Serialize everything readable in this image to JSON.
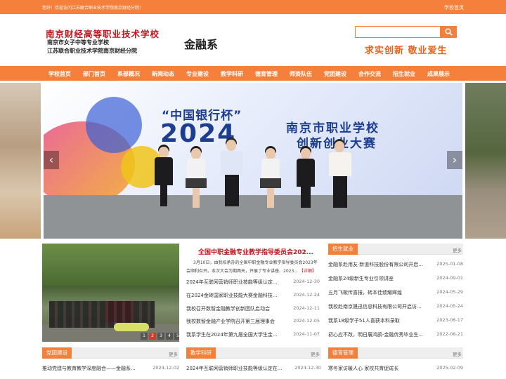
{
  "topbar": {
    "welcome": "您好！欢迎访问江苏联合职业技术学院南京财经分院！",
    "home": "学校首页"
  },
  "header": {
    "school_name": "南京财经高等职业技术学校",
    "sub1": "南京市女子中等专业学校",
    "sub2": "江苏联合职业技术学院南京财经分院",
    "department": "金融系",
    "search_placeholder": "",
    "motto": "求实创新  敬业爱生"
  },
  "nav": [
    "学校首页",
    "部门首页",
    "系部概况",
    "新闻动态",
    "专业建设",
    "教学科研",
    "德育管理",
    "师资队伍",
    "党团建设",
    "合作交流",
    "招生就业",
    "成果展示"
  ],
  "banner": {
    "cup": "“中国银行杯”",
    "year": "2024",
    "comp_line1": "南京市职业学校",
    "comp_line2": "创新创业大赛",
    "prev": "‹",
    "next": "›"
  },
  "news": {
    "pages": [
      "1",
      "2",
      "3",
      "4",
      "5"
    ],
    "active_page": "2",
    "headline": "全国中职金融专业教学指导委员会202...",
    "summary": "3月10日，由我校承办的全国中职金融专业教学指导委员会2023年会顺利召开。本次大会为期两天，开展了专业讲座、2023...",
    "more_link": "【详细】",
    "items": [
      {
        "title": "2024年互联网营销师职业技能等级认定...",
        "date": "2024-12-30"
      },
      {
        "title": "在2024金砖国家职业技能大赛金融科技...",
        "date": "2024-12-24"
      },
      {
        "title": "我校召开数智金融教学创新团队启动会",
        "date": "2024-12-11"
      },
      {
        "title": "我校数智金融产业学院召开第三届理事会",
        "date": "2024-12-05"
      },
      {
        "title": "我系学生在2024年第九届全国大学生金...",
        "date": "2024-11-07"
      }
    ]
  },
  "jobs": {
    "title": "招生就业",
    "more": "更多",
    "items": [
      {
        "title": "金融系赴用友·新道科技股份有限公司开启...",
        "date": "2025-01-08"
      },
      {
        "title": "金融系24级新生专业引领讲座",
        "date": "2024-09-01"
      },
      {
        "title": "五月飞歌传喜报，转本佳绩耀辉煌",
        "date": "2024-05-29"
      },
      {
        "title": "我校赴南京晟迅信息科技有限公司开启访...",
        "date": "2024-05-24"
      },
      {
        "title": "我系18级学子51人喜获本科录取",
        "date": "2023-06-17"
      },
      {
        "title": "初心应不改，明日展鸿鹄-金融优秀毕业生...",
        "date": "2022-06-21"
      }
    ]
  },
  "party": {
    "title": "党团建设",
    "more": "更多",
    "items": [
      {
        "title": "推动党建与教育教学深度融合——金融系...",
        "date": "2024-12-02"
      }
    ]
  },
  "research": {
    "title": "教学科研",
    "more": "更多",
    "items": [
      {
        "title": "2024年互联网营销师职业技能等级认定在...",
        "date": "2024-12-30"
      }
    ]
  },
  "moral": {
    "title": "德育管理",
    "more": "更多",
    "items": [
      {
        "title": "寒冬家访暖人心 家校共育促成长",
        "date": "2025-02-09"
      }
    ]
  }
}
